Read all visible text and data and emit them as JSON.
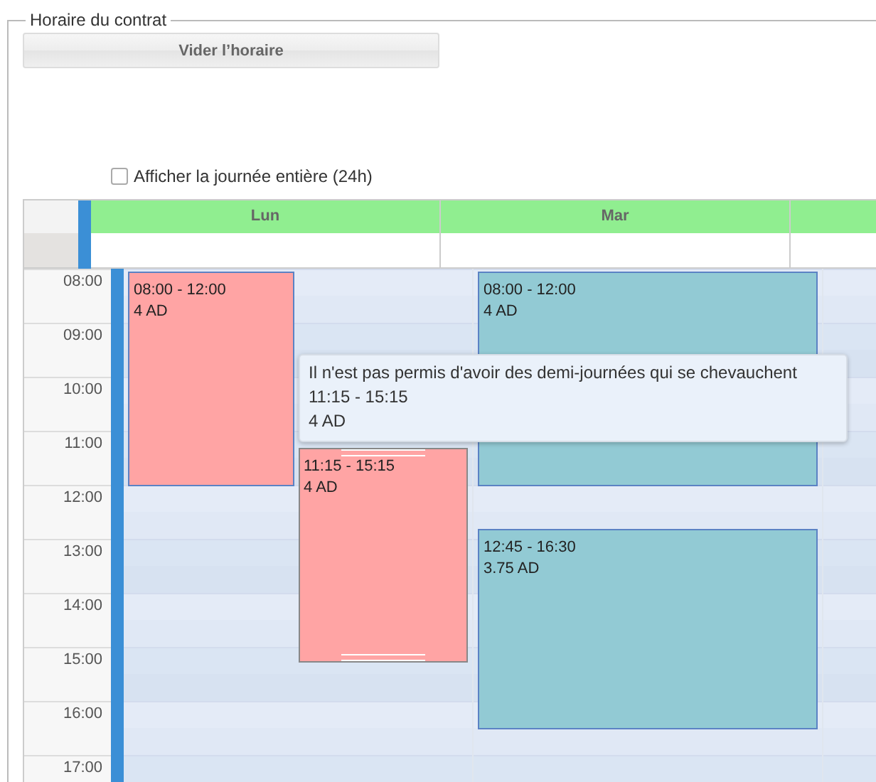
{
  "group": {
    "legend": "Horaire du contrat"
  },
  "clear_button": {
    "label": "Vider l’horaire"
  },
  "full_day": {
    "label": "Afficher la journée entière (24h)",
    "checked": false
  },
  "calendar": {
    "hours": [
      "08:00",
      "09:00",
      "10:00",
      "11:00",
      "12:00",
      "13:00",
      "14:00",
      "15:00",
      "16:00",
      "17:00"
    ],
    "days": [
      {
        "label": "Lun",
        "events": [
          {
            "time": "08:00 - 12:00",
            "amount": "4 AD",
            "color": "#ffa4a4",
            "selected": false
          },
          {
            "time": "11:15 - 15:15",
            "amount": "4 AD",
            "color": "#ffa4a4",
            "selected": true
          }
        ]
      },
      {
        "label": "Mar",
        "events": [
          {
            "time": "08:00 - 12:00",
            "amount": "4 AD",
            "color": "#92cad4",
            "selected": false
          },
          {
            "time": "12:45 - 16:30",
            "amount": "3.75 AD",
            "color": "#92cad4",
            "selected": false
          }
        ]
      }
    ]
  },
  "tooltip": {
    "message": "Il n'est pas permis d'avoir des demi-journées qui se chevauchent",
    "time": "11:15 - 15:15",
    "amount": "4 AD"
  }
}
